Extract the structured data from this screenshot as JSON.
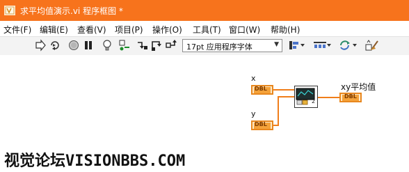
{
  "window": {
    "title": "求平均值演示.vi 程序框图 *"
  },
  "menu": {
    "items": [
      {
        "label": "文件(F)"
      },
      {
        "label": "编辑(E)"
      },
      {
        "label": "查看(V)"
      },
      {
        "label": "项目(P)"
      },
      {
        "label": "操作(O)"
      },
      {
        "label": "工具(T)"
      },
      {
        "label": "窗口(W)"
      },
      {
        "label": "帮助(H)"
      }
    ]
  },
  "toolbar": {
    "font_value": "17pt 应用程序字体"
  },
  "diagram": {
    "controls": [
      {
        "label": "x",
        "type": "DBL"
      },
      {
        "label": "y",
        "type": "DBL"
      }
    ],
    "indicator": {
      "label": "xy平均值",
      "type": "DBL"
    },
    "subvi_text": "2"
  },
  "watermark": "视觉论坛VISIONBBS.COM",
  "colors": {
    "titlebar": "#f7731c",
    "wire": "#f07e1a",
    "terminal_border": "#e8871e"
  }
}
